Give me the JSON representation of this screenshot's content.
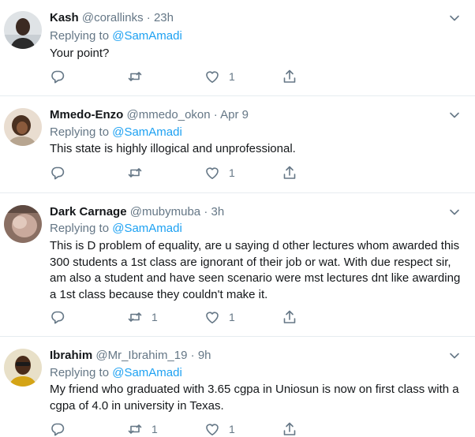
{
  "colors": {
    "link": "#1da1f2",
    "muted": "#657786",
    "text": "#14171a",
    "divider": "#e6ecf0"
  },
  "icons": {
    "reply": "reply-icon",
    "retweet": "retweet-icon",
    "like": "heart-icon",
    "share": "share-icon",
    "caret": "chevron-down-icon"
  },
  "tweets": [
    {
      "name": "Kash",
      "handle": "@corallinks",
      "time": "23h",
      "replying_prefix": "Replying to",
      "replying_to": "@SamAmadi",
      "text": "Your point?",
      "retweets": "",
      "likes": "1"
    },
    {
      "name": "Mmedo-Enzo",
      "handle": "@mmedo_okon",
      "time": "Apr 9",
      "replying_prefix": "Replying to",
      "replying_to": "@SamAmadi",
      "text": "This state is highly illogical and unprofessional.",
      "retweets": "",
      "likes": "1"
    },
    {
      "name": "Dark Carnage",
      "handle": "@mubymuba",
      "time": "3h",
      "replying_prefix": "Replying to",
      "replying_to": "@SamAmadi",
      "text": "This is D problem of equality, are u saying d other lectures whom awarded this 300 students a 1st class are ignorant of their job or wat. With due respect sir, am also a student and have seen scenario  were mst lectures dnt like awarding a 1st class because they couldn't make it.",
      "retweets": "1",
      "likes": "1"
    },
    {
      "name": "Ibrahim",
      "handle": "@Mr_Ibrahim_19",
      "time": "9h",
      "replying_prefix": "Replying to",
      "replying_to": "@SamAmadi",
      "text": "My friend who graduated with 3.65 cgpa in Uniosun is now on first class with a cgpa of 4.0 in university in Texas.",
      "retweets": "1",
      "likes": "1"
    }
  ]
}
